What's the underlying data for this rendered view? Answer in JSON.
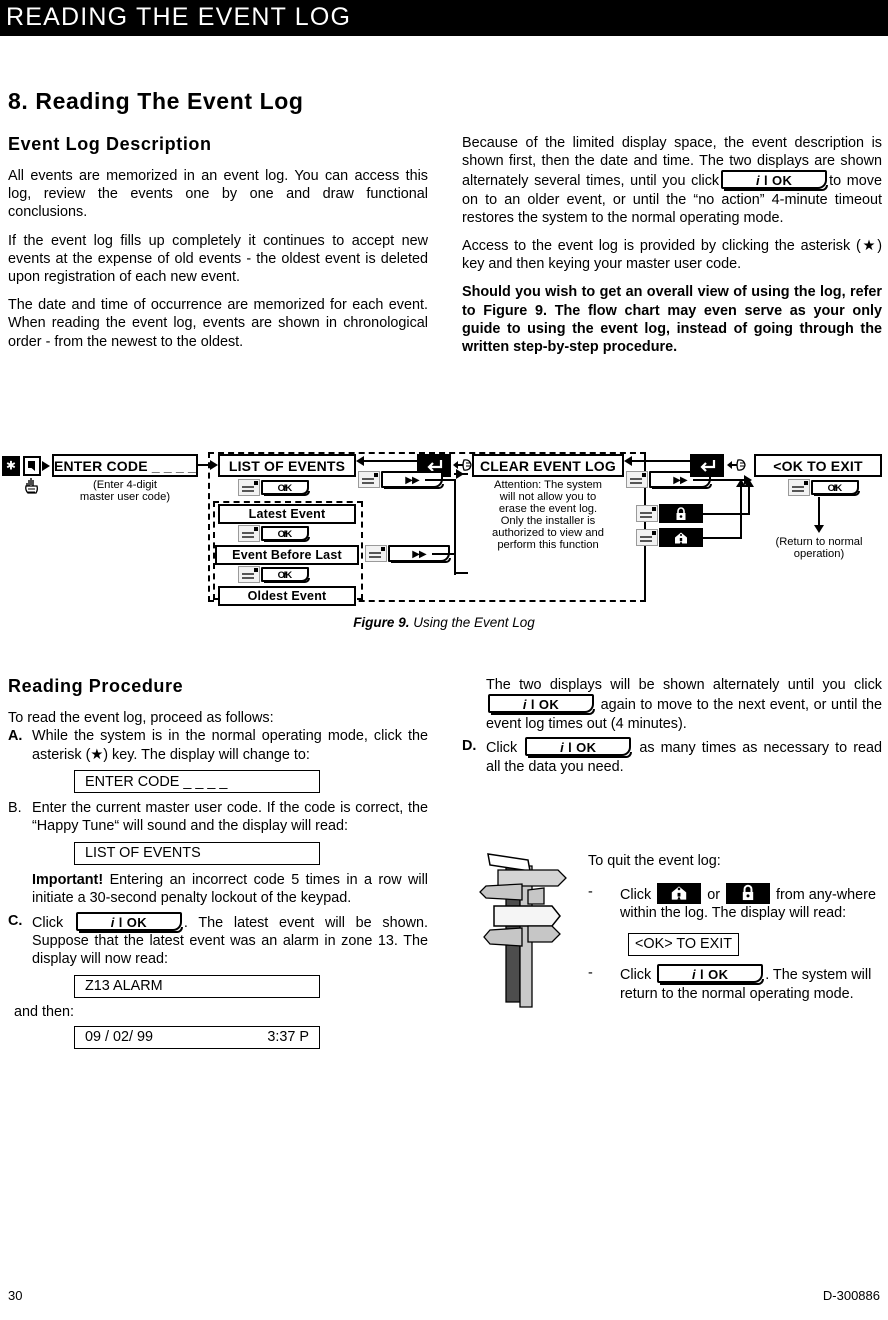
{
  "header": {
    "running_title": "READING THE EVENT LOG"
  },
  "chapter": {
    "title": "8. Reading The Event Log"
  },
  "event_log_description": {
    "heading": "Event Log Description",
    "p1": "All events are memorized in an event log. You can access this log, review the events one by one and draw functional conclusions.",
    "p2": "If the event log fills up completely it continues to accept new events at the expense of old events - the oldest event is deleted upon registration of each new event.",
    "p3": "The date and time of occurrence are memorized for each event. When reading the event log, events are shown in chronological order - from the newest to the oldest.",
    "p4_a": "Because of the limited display space, the event description is shown first, then the date and time. The two displays are shown alternately several times, until you click",
    "p4_b": "to move on to an older event, or until the “no action” 4-minute timeout restores the system to the normal operating mode.",
    "p5": "Access to the event log is provided by clicking the asterisk (★) key and then keying your master user code.",
    "p6": "Should you wish to get an overall view of using the log, refer to Figure 9. The flow chart may even serve as your only guide to using the event log, instead of going through the written step-by-step procedure."
  },
  "figure": {
    "caption_label": "Figure 9.",
    "caption_text": "Using the Event Log",
    "start_keys": {
      "asterisk": "asterisk-key",
      "next": "next-key",
      "hand": "pointing-hand"
    },
    "enter_code_display": "ENTER CODE _ _ _ _",
    "enter_code_note_l1": "(Enter 4-digit",
    "enter_code_note_l2": "master user code)",
    "list_of_events_display": "LIST OF EVENTS",
    "latest_event_display": "Latest Event",
    "event_before_last_display": "Event Before Last",
    "oldest_event_display": "Oldest Event",
    "clear_event_log_display": "CLEAR EVENT LOG",
    "clear_note_l1": "Attention: The system",
    "clear_note_l2": "will not allow you to",
    "clear_note_l3": "erase the event log.",
    "clear_note_l4": "Only the installer is",
    "clear_note_l5": "authorized to view and",
    "clear_note_l6": "perform this function",
    "ok_to_exit_display": "<OK TO EXIT",
    "return_note_l1": "(Return to normal",
    "return_note_l2": "operation)",
    "ok_key_label_i": "i",
    "ok_key_label_bar": "l",
    "ok_key_label_ok": "OK",
    "next_key_label": "▶▶"
  },
  "reading_procedure": {
    "heading": "Reading Procedure",
    "intro": "To read the event log, proceed as follows:",
    "steps": [
      {
        "letter": "A.",
        "text": "While the system is in the normal operating mode, click the asterisk (★) key. The display will change to:"
      },
      {
        "letter": "B.",
        "text": "Enter the current master user code. If the code is correct, the “Happy Tune“ will sound and the display will read:"
      }
    ],
    "display_enter_code": "ENTER CODE _ _ _ _",
    "display_list_of_events": "LIST OF EVENTS",
    "important_label": "Important!",
    "important_text": "Entering an incorrect code 5 times in a row will initiate a 30-second penalty lockout of the keypad.",
    "step_c_letter": "C.",
    "step_c_pre": "Click",
    "step_c_post": ". The latest event will be shown. Suppose that the latest event was an alarm in zone 13. The display will now read:",
    "display_z13": "Z13 ALARM",
    "and_then": "and then:",
    "display_date": "09 / 02/ 99",
    "display_time": "3:37 P",
    "right_p1": "The two displays will be shown alternately until you click",
    "right_p1b": "again to move to the next event, or until the event log times out (4 minutes).",
    "step_d_letter": "D.",
    "step_d_pre": "Click",
    "step_d_post": "as many times as necessary to read all the data you need."
  },
  "quit_section": {
    "title": "To quit the event log:",
    "bullet_dash": "-",
    "q1_pre": "Click",
    "q1_mid": "or",
    "q1_post": "from any-where within the log. The display will read:",
    "display_ok_to_exit": "<OK> TO EXIT",
    "q2_pre": "Click",
    "q2_post": ". The system will return to the normal operating mode.",
    "home_icon": "home-arm-icon",
    "lock_icon": "lock-arm-icon"
  },
  "footer": {
    "page_number": "30",
    "doc_number": "D-300886"
  }
}
